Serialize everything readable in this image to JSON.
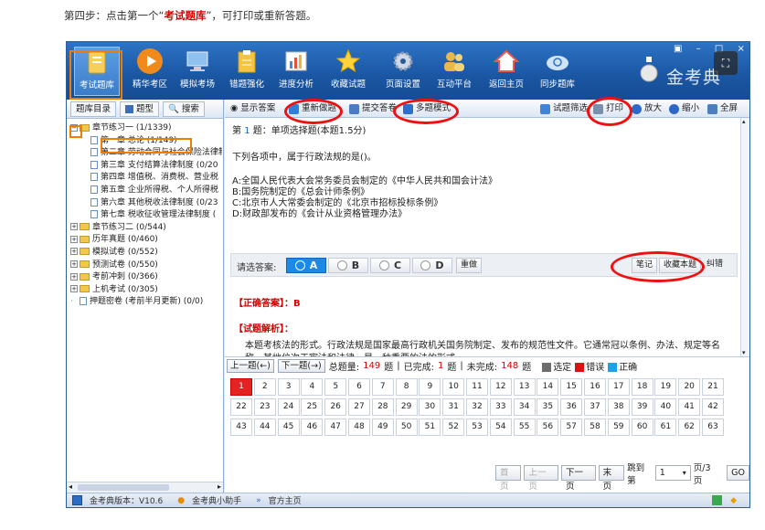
{
  "instruction": {
    "prefix": "第四步：点击第一个“",
    "highlight": "考试题库",
    "suffix": "”，可打印或重新答题。"
  },
  "toolbar": {
    "items": [
      {
        "label": "考试题库",
        "icon": "book-icon"
      },
      {
        "label": "精华考区",
        "icon": "play-icon"
      },
      {
        "label": "模拟考场",
        "icon": "monitor-icon"
      },
      {
        "label": "错题强化",
        "icon": "clipboard-icon"
      },
      {
        "label": "进度分析",
        "icon": "chart-icon"
      },
      {
        "label": "收藏试题",
        "icon": "star-icon"
      },
      {
        "label": "页面设置",
        "icon": "gear-icon"
      },
      {
        "label": "互动平台",
        "icon": "users-icon"
      },
      {
        "label": "返回主页",
        "icon": "home-icon"
      },
      {
        "label": "同步题库",
        "icon": "cloud-sync-icon"
      }
    ],
    "brand": "金考典"
  },
  "sidebar": {
    "tabs": [
      "题库目录",
      "题型",
      "搜索"
    ],
    "tree": [
      {
        "label": "章节练习一 (1/1339)",
        "level": 0,
        "type": "folder",
        "expanded": true
      },
      {
        "label": "第一章 总论 (1/149)",
        "level": 1,
        "type": "doc",
        "selected": true
      },
      {
        "label": "第二章 劳动合同与社会保险法律制度",
        "level": 1,
        "type": "doc"
      },
      {
        "label": "第三章 支付结算法律制度 (0/20",
        "level": 1,
        "type": "doc"
      },
      {
        "label": "第四章 增值税、消费税、营业税",
        "level": 1,
        "type": "doc"
      },
      {
        "label": "第五章 企业所得税、个人所得税",
        "level": 1,
        "type": "doc"
      },
      {
        "label": "第六章 其他税收法律制度 (0/23",
        "level": 1,
        "type": "doc"
      },
      {
        "label": "第七章 税收征收管理法律制度 (",
        "level": 1,
        "type": "doc"
      },
      {
        "label": "章节练习二 (0/544)",
        "level": 0,
        "type": "folder"
      },
      {
        "label": "历年真题 (0/460)",
        "level": 0,
        "type": "folder"
      },
      {
        "label": "模拟试卷 (0/552)",
        "level": 0,
        "type": "folder"
      },
      {
        "label": "预测试卷 (0/550)",
        "level": 0,
        "type": "folder"
      },
      {
        "label": "考前冲刺 (0/366)",
        "level": 0,
        "type": "folder"
      },
      {
        "label": "上机考试 (0/305)",
        "level": 0,
        "type": "folder"
      },
      {
        "label": "押题密卷 (考前半月更新) (0/0)",
        "level": 0,
        "type": "doc-plain"
      }
    ]
  },
  "main_toolbar": {
    "show_answer": "显示答案",
    "redo": "重新做题",
    "submit": "提交答卷",
    "multi_mode": "多题模式",
    "filter": "试题筛选",
    "print": "打印",
    "zoom_in": "放大",
    "zoom_out": "缩小",
    "fullscreen": "全屏"
  },
  "question": {
    "prefix": "第",
    "number": "1",
    "suffix": "题：单项选择题(本题1.5分)",
    "stem": "下列各项中，属于行政法规的是()。",
    "options": [
      "A:全国人民代表大会常务委员会制定的《中华人民共和国会计法》",
      "B:国务院制定的《总会计师条例》",
      "C:北京市人大常委会制定的《北京市招标投标条例》",
      "D:财政部发布的《会计从业资格管理办法》"
    ]
  },
  "answer_bar": {
    "label": "请选答案:",
    "choices": [
      "A",
      "B",
      "C",
      "D"
    ],
    "selected": "A",
    "redo": "重做",
    "note": "笔记",
    "favorite": "收藏本题",
    "correct_error": "纠错"
  },
  "result": {
    "correct_label": "【正确答案】：B",
    "analysis_label": "【试题解析】：",
    "analysis_text": "本题考核法的形式。行政法规是国家最高行政机关国务院制定、发布的规范性文件。它通常冠以条例、办法、规定等名称。其地位次于宪法和法律，是一种重要的法的形式。"
  },
  "nav": {
    "prev": "上一题(←)",
    "next": "下一题(→)",
    "total_label": "总题量:",
    "total": "149",
    "unit": "题",
    "done_label": "已完成:",
    "done": "1",
    "undone_label": "未完成:",
    "undone": "148",
    "legend": [
      {
        "label": "选定",
        "color": "#6d6d6d"
      },
      {
        "label": "错误",
        "color": "#e01010"
      },
      {
        "label": "正确",
        "color": "#1aa3e8"
      }
    ]
  },
  "grid_numbers": [
    "1",
    "2",
    "3",
    "4",
    "5",
    "6",
    "7",
    "8",
    "9",
    "10",
    "11",
    "12",
    "13",
    "14",
    "15",
    "16",
    "17",
    "18",
    "19",
    "20",
    "21",
    "22",
    "23",
    "24",
    "25",
    "26",
    "27",
    "28",
    "29",
    "30",
    "31",
    "32",
    "33",
    "34",
    "35",
    "36",
    "37",
    "38",
    "39",
    "40",
    "41",
    "42",
    "43",
    "44",
    "45",
    "46",
    "47",
    "48",
    "49",
    "50",
    "51",
    "52",
    "53",
    "54",
    "55",
    "56",
    "57",
    "58",
    "59",
    "60",
    "61",
    "62",
    "63"
  ],
  "pager": {
    "first": "首页",
    "prev": "上一页",
    "next": "下一页",
    "last": "末页",
    "jump_label": "跳到第",
    "page": "1",
    "page_total": "页/3页",
    "go": "GO"
  },
  "statusbar": {
    "version": "金考典版本：V10.6",
    "assistant": "金考典小助手",
    "homepage": "官方主页"
  }
}
